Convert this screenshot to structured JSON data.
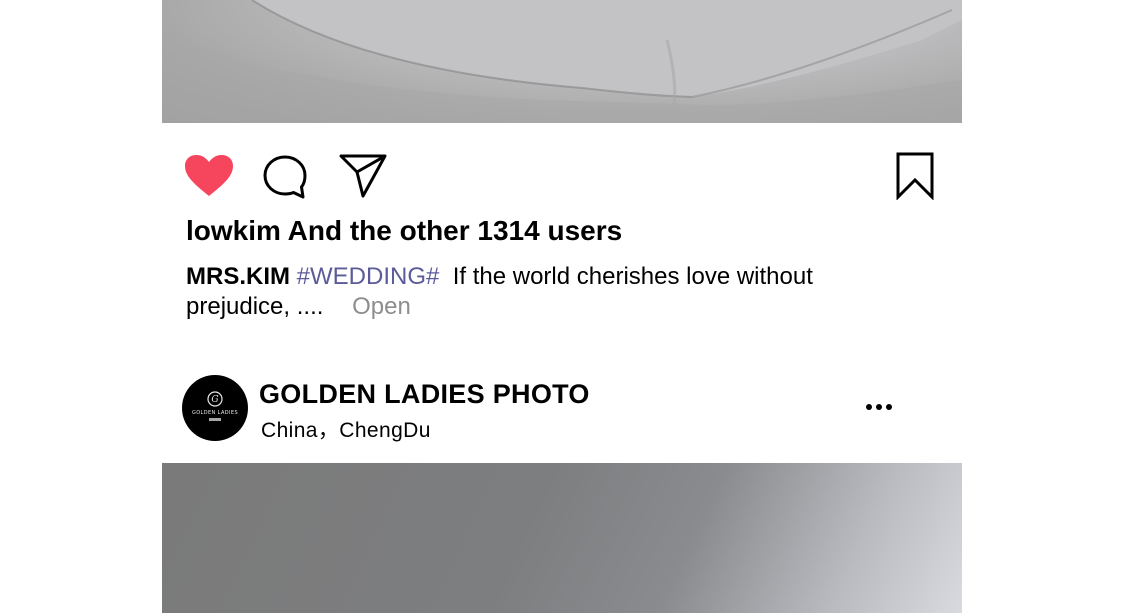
{
  "post1": {
    "likes_text": "lowkim And the other 1314 users",
    "caption": {
      "username": "MRS.KIM",
      "hashtag": "#WEDDING#",
      "text": "If the world cherishes love without prejudice, ....",
      "more_label": "Open"
    },
    "icons": {
      "like": "heart-icon",
      "comment": "comment-icon",
      "share": "paper-plane-icon",
      "save": "bookmark-icon"
    },
    "like_color": "#f5465d"
  },
  "post2": {
    "account_name": "GOLDEN LADIES PHOTO",
    "location": "China，ChengDu",
    "avatar_text": "GOLDEN LADIES",
    "options_icon": "more-options-icon"
  }
}
